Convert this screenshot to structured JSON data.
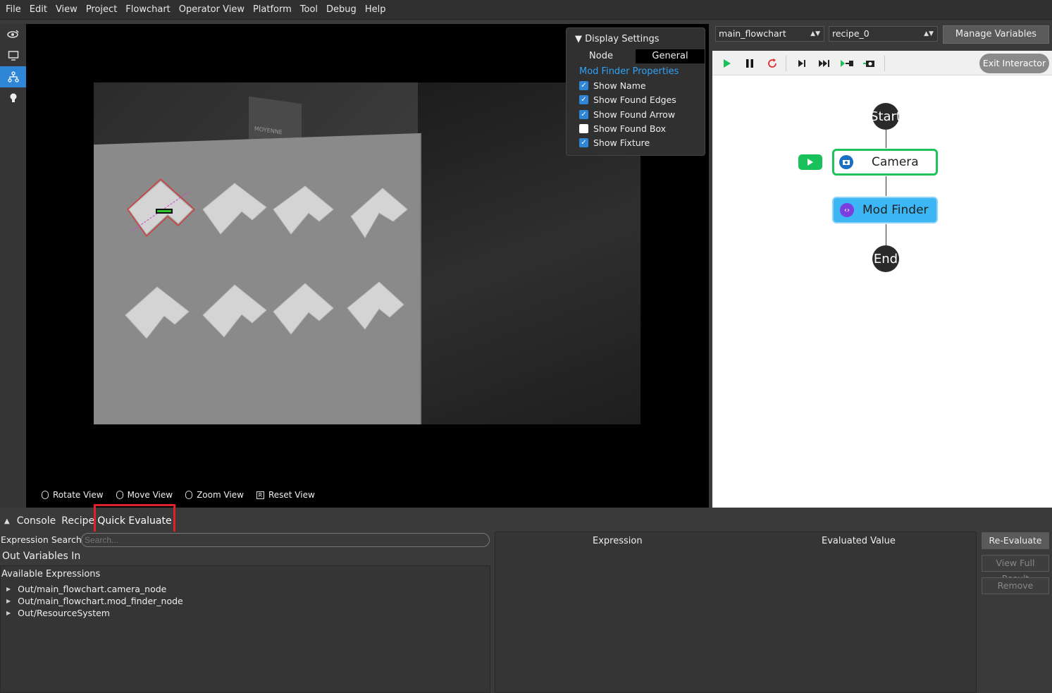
{
  "menu": [
    "File",
    "Edit",
    "View",
    "Project",
    "Flowchart",
    "Operator View",
    "Platform",
    "Tool",
    "Debug",
    "Help"
  ],
  "viewer": {
    "controls": [
      {
        "label": "Rotate View",
        "icon": "mouse-left-icon"
      },
      {
        "label": "Move View",
        "icon": "mouse-right-icon"
      },
      {
        "label": "Zoom View",
        "icon": "mouse-scroll-icon"
      },
      {
        "label": "Reset View",
        "icon": "key-r-icon",
        "key": "R"
      }
    ],
    "display_settings": {
      "title": "Display Settings",
      "tabs": [
        "Node",
        "General"
      ],
      "selected_tab": "General",
      "section": "Mod Finder Properties",
      "options": [
        {
          "label": "Show Name",
          "checked": true
        },
        {
          "label": "Show Found Edges",
          "checked": true
        },
        {
          "label": "Show Found Arrow",
          "checked": true
        },
        {
          "label": "Show Found Box",
          "checked": false
        },
        {
          "label": "Show Fixture",
          "checked": true
        }
      ]
    },
    "box_label_text": "MOYENNE"
  },
  "flow_panel": {
    "flowchart_select": "main_flowchart",
    "recipe_select": "recipe_0",
    "manage_variables": "Manage Variables",
    "exit_interactor": "Exit Interactor",
    "nodes": {
      "start": "Start",
      "camera": "Camera",
      "mod_finder": "Mod Finder",
      "end": "End"
    },
    "colors": {
      "camera_border": "#1ec15a",
      "mod_finder_fill": "#3db6f5",
      "run_button": "#19c15a"
    }
  },
  "bottom": {
    "tabs": [
      "Console",
      "Recipes",
      "Quick Evaluate"
    ],
    "active_tab": "Quick Evaluate",
    "expression_search_label": "Expression Search:",
    "search_placeholder": "Search...",
    "out_vars_label": "Out Variables In",
    "available_label": "Available Expressions",
    "expressions": [
      "Out/main_flowchart.camera_node",
      "Out/main_flowchart.mod_finder_node",
      "Out/ResourceSystem"
    ],
    "columns": [
      "Expression",
      "Evaluated Value"
    ],
    "buttons": {
      "reevaluate": "Re-Evaluate",
      "view_full": "View Full Result",
      "remove": "Remove"
    }
  }
}
